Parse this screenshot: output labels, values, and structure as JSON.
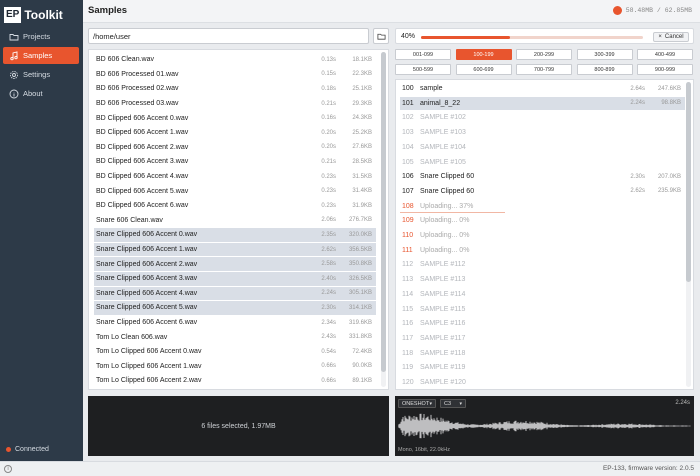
{
  "app": {
    "logo_mark": "EP",
    "logo_text": "Toolkit"
  },
  "sidebar": {
    "items": [
      {
        "label": "Projects",
        "icon": "folder-icon",
        "active": false
      },
      {
        "label": "Samples",
        "icon": "music-note-icon",
        "active": true
      },
      {
        "label": "Settings",
        "icon": "gear-icon",
        "active": false
      },
      {
        "label": "About",
        "icon": "info-icon",
        "active": false
      }
    ],
    "connection": "Connected"
  },
  "header": {
    "title": "Samples",
    "storage": "58.48MB / 62.85MB",
    "storage_fraction": 0.93
  },
  "browser": {
    "path": "/home/user",
    "files": [
      {
        "name": "BD 606 Clean.wav",
        "duration": "0.13s",
        "size": "18.1KB",
        "selected": false
      },
      {
        "name": "BD 606 Processed 01.wav",
        "duration": "0.15s",
        "size": "22.3KB",
        "selected": false
      },
      {
        "name": "BD 606 Processed 02.wav",
        "duration": "0.18s",
        "size": "25.1KB",
        "selected": false
      },
      {
        "name": "BD 606 Processed 03.wav",
        "duration": "0.21s",
        "size": "29.3KB",
        "selected": false
      },
      {
        "name": "BD Clipped 606 Accent 0.wav",
        "duration": "0.16s",
        "size": "24.3KB",
        "selected": false
      },
      {
        "name": "BD Clipped 606 Accent 1.wav",
        "duration": "0.20s",
        "size": "25.2KB",
        "selected": false
      },
      {
        "name": "BD Clipped 606 Accent 2.wav",
        "duration": "0.20s",
        "size": "27.6KB",
        "selected": false
      },
      {
        "name": "BD Clipped 606 Accent 3.wav",
        "duration": "0.21s",
        "size": "28.5KB",
        "selected": false
      },
      {
        "name": "BD Clipped 606 Accent 4.wav",
        "duration": "0.23s",
        "size": "31.5KB",
        "selected": false
      },
      {
        "name": "BD Clipped 606 Accent 5.wav",
        "duration": "0.23s",
        "size": "31.4KB",
        "selected": false
      },
      {
        "name": "BD Clipped 606 Accent 6.wav",
        "duration": "0.23s",
        "size": "31.9KB",
        "selected": false
      },
      {
        "name": "Snare 606 Clean.wav",
        "duration": "2.06s",
        "size": "276.7KB",
        "selected": false
      },
      {
        "name": "Snare Clipped 606 Accent 0.wav",
        "duration": "2.35s",
        "size": "320.0KB",
        "selected": true
      },
      {
        "name": "Snare Clipped 606 Accent 1.wav",
        "duration": "2.62s",
        "size": "356.5KB",
        "selected": true
      },
      {
        "name": "Snare Clipped 606 Accent 2.wav",
        "duration": "2.58s",
        "size": "350.8KB",
        "selected": true
      },
      {
        "name": "Snare Clipped 606 Accent 3.wav",
        "duration": "2.40s",
        "size": "326.5KB",
        "selected": true
      },
      {
        "name": "Snare Clipped 606 Accent 4.wav",
        "duration": "2.24s",
        "size": "305.1KB",
        "selected": true
      },
      {
        "name": "Snare Clipped 606 Accent 5.wav",
        "duration": "2.30s",
        "size": "314.1KB",
        "selected": true
      },
      {
        "name": "Snare Clipped 606 Accent 6.wav",
        "duration": "2.34s",
        "size": "319.6KB",
        "selected": false
      },
      {
        "name": "Tom Lo Clean 606.wav",
        "duration": "2.43s",
        "size": "331.8KB",
        "selected": false
      },
      {
        "name": "Tom Lo Clipped 606 Accent 0.wav",
        "duration": "0.54s",
        "size": "72.4KB",
        "selected": false
      },
      {
        "name": "Tom Lo Clipped 606 Accent 1.wav",
        "duration": "0.66s",
        "size": "90.0KB",
        "selected": false
      },
      {
        "name": "Tom Lo Clipped 606 Accent 2.wav",
        "duration": "0.66s",
        "size": "89.1KB",
        "selected": false
      }
    ],
    "status": "6 files selected, 1.97MB"
  },
  "upload": {
    "percent_label": "40%",
    "progress": 0.4,
    "cancel_label": "Cancel"
  },
  "ranges": [
    "001-099",
    "100-199",
    "200-299",
    "300-399",
    "400-499",
    "500-599",
    "600-699",
    "700-799",
    "800-899",
    "900-999"
  ],
  "active_range": 1,
  "slots": [
    {
      "num": "100",
      "name": "sample",
      "duration": "2.64s",
      "size": "247.6KB",
      "state": "filled",
      "progress": null
    },
    {
      "num": "101",
      "name": "animal_8_22",
      "duration": "2.24s",
      "size": "98.8KB",
      "state": "selected",
      "progress": null
    },
    {
      "num": "102",
      "name": "SAMPLE #102",
      "duration": "",
      "size": "",
      "state": "empty",
      "progress": null
    },
    {
      "num": "103",
      "name": "SAMPLE #103",
      "duration": "",
      "size": "",
      "state": "empty",
      "progress": null
    },
    {
      "num": "104",
      "name": "SAMPLE #104",
      "duration": "",
      "size": "",
      "state": "empty",
      "progress": null
    },
    {
      "num": "105",
      "name": "SAMPLE #105",
      "duration": "",
      "size": "",
      "state": "empty",
      "progress": null
    },
    {
      "num": "106",
      "name": "Snare Clipped 60",
      "duration": "2.30s",
      "size": "207.0KB",
      "state": "filled",
      "progress": null
    },
    {
      "num": "107",
      "name": "Snare Clipped 60",
      "duration": "2.62s",
      "size": "235.9KB",
      "state": "filled",
      "progress": null
    },
    {
      "num": "108",
      "name": "Uploading... 37%",
      "duration": "",
      "size": "",
      "state": "uploading",
      "progress": 0.37
    },
    {
      "num": "109",
      "name": "Uploading... 0%",
      "duration": "",
      "size": "",
      "state": "uploading",
      "progress": 0
    },
    {
      "num": "110",
      "name": "Uploading... 0%",
      "duration": "",
      "size": "",
      "state": "uploading",
      "progress": 0
    },
    {
      "num": "111",
      "name": "Uploading... 0%",
      "duration": "",
      "size": "",
      "state": "uploading",
      "progress": 0
    },
    {
      "num": "112",
      "name": "SAMPLE #112",
      "duration": "",
      "size": "",
      "state": "empty",
      "progress": null
    },
    {
      "num": "113",
      "name": "SAMPLE #113",
      "duration": "",
      "size": "",
      "state": "empty",
      "progress": null
    },
    {
      "num": "114",
      "name": "SAMPLE #114",
      "duration": "",
      "size": "",
      "state": "empty",
      "progress": null
    },
    {
      "num": "115",
      "name": "SAMPLE #115",
      "duration": "",
      "size": "",
      "state": "empty",
      "progress": null
    },
    {
      "num": "116",
      "name": "SAMPLE #116",
      "duration": "",
      "size": "",
      "state": "empty",
      "progress": null
    },
    {
      "num": "117",
      "name": "SAMPLE #117",
      "duration": "",
      "size": "",
      "state": "empty",
      "progress": null
    },
    {
      "num": "118",
      "name": "SAMPLE #118",
      "duration": "",
      "size": "",
      "state": "empty",
      "progress": null
    },
    {
      "num": "119",
      "name": "SAMPLE #119",
      "duration": "",
      "size": "",
      "state": "empty",
      "progress": null
    },
    {
      "num": "120",
      "name": "SAMPLE #120",
      "duration": "",
      "size": "",
      "state": "empty",
      "progress": null
    }
  ],
  "sample_preview": {
    "mode": "ONESHOT",
    "note": "C3",
    "duration": "2.24s",
    "format": "Mono, 16bit, 22.0kHz"
  },
  "footer": {
    "info_icon": "info-icon",
    "firmware": "EP-133, firmware version: 2.0.5"
  },
  "colors": {
    "accent": "#e8552e",
    "sidebar": "#2d3a48",
    "selected_row": "#d9dee6",
    "dark_panel": "#1e1f21"
  }
}
